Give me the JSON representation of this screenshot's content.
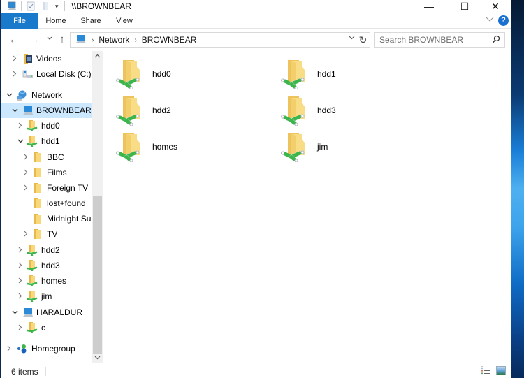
{
  "window": {
    "title": "\\\\BROWNBEAR",
    "controls": {
      "minimize": "—",
      "maximize": "☐",
      "close": "✕"
    }
  },
  "ribbon": {
    "tabs": [
      {
        "label": "File",
        "active": true
      },
      {
        "label": "Home"
      },
      {
        "label": "Share"
      },
      {
        "label": "View"
      }
    ],
    "help": "?"
  },
  "nav": {
    "back": "←",
    "forward": "→",
    "recent": "⌄",
    "up": "↑",
    "breadcrumb": [
      "Network",
      "BROWNBEAR"
    ],
    "refresh": "↻",
    "search_placeholder": "Search BROWNBEAR"
  },
  "tree": [
    {
      "label": "Videos",
      "icon": "videos-folder-icon",
      "level": 1,
      "expander": "collapsed"
    },
    {
      "label": "Local Disk (C:)",
      "icon": "local-disk-icon",
      "level": 1,
      "expander": "collapsed"
    },
    {
      "label": "Network",
      "icon": "network-icon",
      "level": 0,
      "expander": "expanded"
    },
    {
      "label": "BROWNBEAR",
      "icon": "computer-icon",
      "level": 1,
      "expander": "expanded",
      "selected": true
    },
    {
      "label": "hdd0",
      "icon": "network-share-icon",
      "level": 2,
      "expander": "collapsed"
    },
    {
      "label": "hdd1",
      "icon": "network-share-icon",
      "level": 2,
      "expander": "expanded"
    },
    {
      "label": "BBC",
      "icon": "folder-icon",
      "level": 3,
      "expander": "collapsed"
    },
    {
      "label": "Films",
      "icon": "folder-icon",
      "level": 3,
      "expander": "collapsed"
    },
    {
      "label": "Foreign TV",
      "icon": "folder-icon",
      "level": 3,
      "expander": "collapsed"
    },
    {
      "label": "lost+found",
      "icon": "folder-icon",
      "level": 3,
      "expander": "none"
    },
    {
      "label": "Midnight Sun",
      "icon": "folder-icon",
      "level": 3,
      "expander": "none"
    },
    {
      "label": "TV",
      "icon": "folder-icon",
      "level": 3,
      "expander": "collapsed"
    },
    {
      "label": "hdd2",
      "icon": "network-share-icon",
      "level": 2,
      "expander": "collapsed"
    },
    {
      "label": "hdd3",
      "icon": "network-share-icon",
      "level": 2,
      "expander": "collapsed"
    },
    {
      "label": "homes",
      "icon": "network-share-icon",
      "level": 2,
      "expander": "collapsed"
    },
    {
      "label": "jim",
      "icon": "network-share-icon",
      "level": 2,
      "expander": "collapsed"
    },
    {
      "label": "HARALDUR",
      "icon": "computer-icon",
      "level": 1,
      "expander": "expanded"
    },
    {
      "label": "c",
      "icon": "network-share-icon",
      "level": 2,
      "expander": "collapsed"
    },
    {
      "label": "Homegroup",
      "icon": "homegroup-icon",
      "level": 0,
      "expander": "collapsed"
    }
  ],
  "content": {
    "items": [
      {
        "name": "hdd0"
      },
      {
        "name": "hdd1"
      },
      {
        "name": "hdd2"
      },
      {
        "name": "hdd3"
      },
      {
        "name": "homes"
      },
      {
        "name": "jim"
      }
    ]
  },
  "status": {
    "item_count": "6 items"
  },
  "colors": {
    "accent": "#1979ca",
    "selection": "#cce8ff",
    "folder": "#f6d57a",
    "share_pipe": "#3cb64a"
  }
}
